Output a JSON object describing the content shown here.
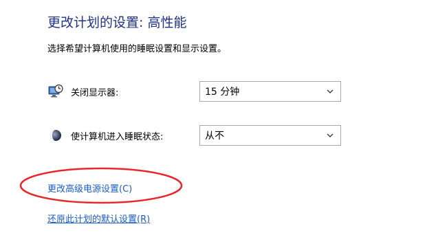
{
  "header": {
    "title": "更改计划的设置: 高性能",
    "subtitle": "选择希望计算机使用的睡眠设置和显示设置。"
  },
  "settings": [
    {
      "label": "关闭显示器:",
      "icon": "monitor-clock-icon",
      "value": "15 分钟"
    },
    {
      "label": "使计算机进入睡眠状态:",
      "icon": "moon-sleep-icon",
      "value": "从不"
    }
  ],
  "links": {
    "advanced": "更改高级电源设置(C)",
    "restore": "还原此计划的默认设置(R)"
  },
  "colors": {
    "title": "#1e3287",
    "link": "#1a5cc8",
    "annotation": "#e8262b"
  }
}
